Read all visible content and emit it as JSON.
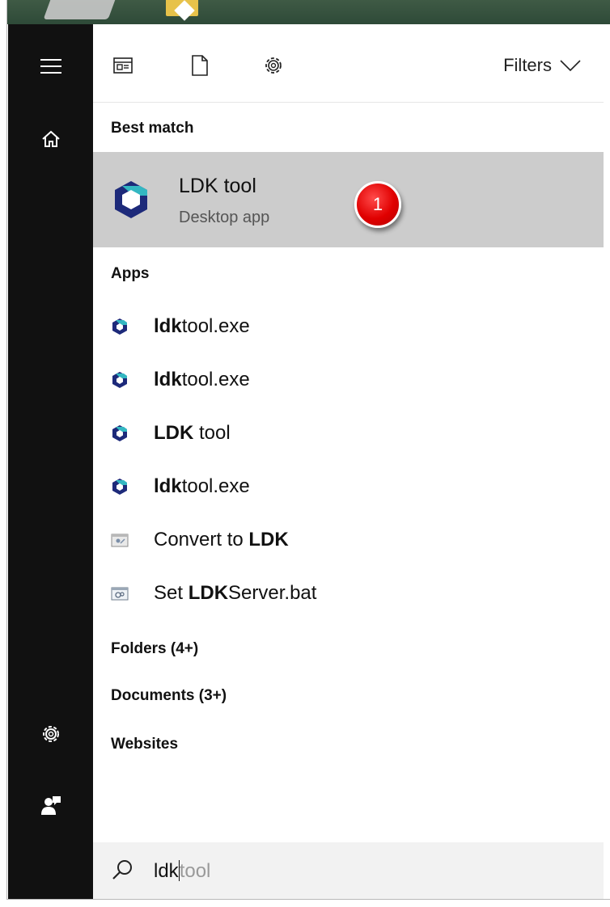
{
  "toolbar": {
    "filters_label": "Filters"
  },
  "best_match": {
    "heading": "Best match",
    "title": "LDK tool",
    "subtitle": "Desktop app",
    "badge_number": "1"
  },
  "apps": {
    "heading": "Apps",
    "items": [
      {
        "bold": "ldk",
        "rest": "tool.exe",
        "icon": "ldk-app-icon"
      },
      {
        "bold": "ldk",
        "rest": "tool.exe",
        "icon": "ldk-app-icon"
      },
      {
        "bold": "LDK",
        "rest": " tool",
        "icon": "ldk-app-icon"
      },
      {
        "bold": "ldk",
        "rest": "tool.exe",
        "icon": "ldk-app-icon"
      },
      {
        "pre": "Convert to ",
        "bold": "LDK",
        "rest": "",
        "icon": "shortcut-icon"
      },
      {
        "pre": "Set ",
        "bold": "LDK",
        "rest": "Server.bat",
        "icon": "batch-file-icon"
      }
    ]
  },
  "categories": [
    {
      "label": "Folders (4+)"
    },
    {
      "label": "Documents (3+)"
    },
    {
      "label": "Websites"
    }
  ],
  "search": {
    "typed": "ldk",
    "suggestion": "tool"
  },
  "colors": {
    "rail_bg": "#111111",
    "selected_bg": "#cccccc",
    "badge_red": "#e00000",
    "ldk_blue": "#1d2a7a",
    "ldk_teal": "#33b7c2"
  }
}
